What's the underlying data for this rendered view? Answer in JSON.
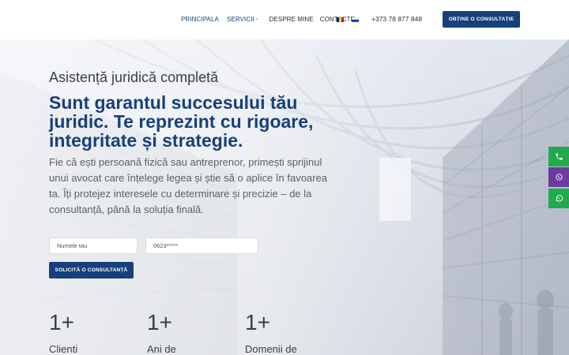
{
  "header": {
    "nav": [
      {
        "label": "PRINCIPALA",
        "active": true
      },
      {
        "label": "SERVICII",
        "active": true,
        "has_dropdown": true
      },
      {
        "label": "DESPRE MINE",
        "active": false
      },
      {
        "label": "CONTACTE",
        "active": false
      }
    ],
    "languages": [
      {
        "code": "ro",
        "icon": "romanian-flag-icon",
        "colors": [
          "#002b7f",
          "#fcd116",
          "#ce1126"
        ]
      },
      {
        "code": "ru",
        "icon": "russian-flag-icon",
        "colors": [
          "#ffffff",
          "#0039a6",
          "#d52b1e"
        ]
      }
    ],
    "phone": "+373 78 877 848",
    "cta_label": "OBȚINE O CONSULTAȚIE"
  },
  "hero": {
    "kicker": "Asistență juridică completă",
    "headline": "Sunt garantul succesului tău juridic. Te reprezint cu rigoare, integritate și strategie.",
    "lead": "Fie că ești persoană fizică sau antreprenor, primești sprijinul unui avocat care înțelege legea și știe să o aplice în favoarea ta. Îți protejez interesele cu determinare și precizie – de la consultanță, până la soluția finală.",
    "form": {
      "name_placeholder": "Numele tau",
      "phone_placeholder": "0623*****",
      "submit_label": "SOLICITĂ O CONSULTANȚĂ"
    },
    "stats": [
      {
        "value": "1+",
        "label": "Clienti"
      },
      {
        "value": "1+",
        "label": "Ani de"
      },
      {
        "value": "1+",
        "label": "Domenii de"
      }
    ],
    "background": "library-hall-image"
  },
  "side_contacts": [
    {
      "icon": "phone-icon",
      "color": "#1faa4d"
    },
    {
      "icon": "viber-icon",
      "color": "#6d3aa0"
    },
    {
      "icon": "whatsapp-icon",
      "color": "#1faa4d"
    }
  ],
  "colors": {
    "brand": "#17407a",
    "text": "#3a3f47"
  }
}
